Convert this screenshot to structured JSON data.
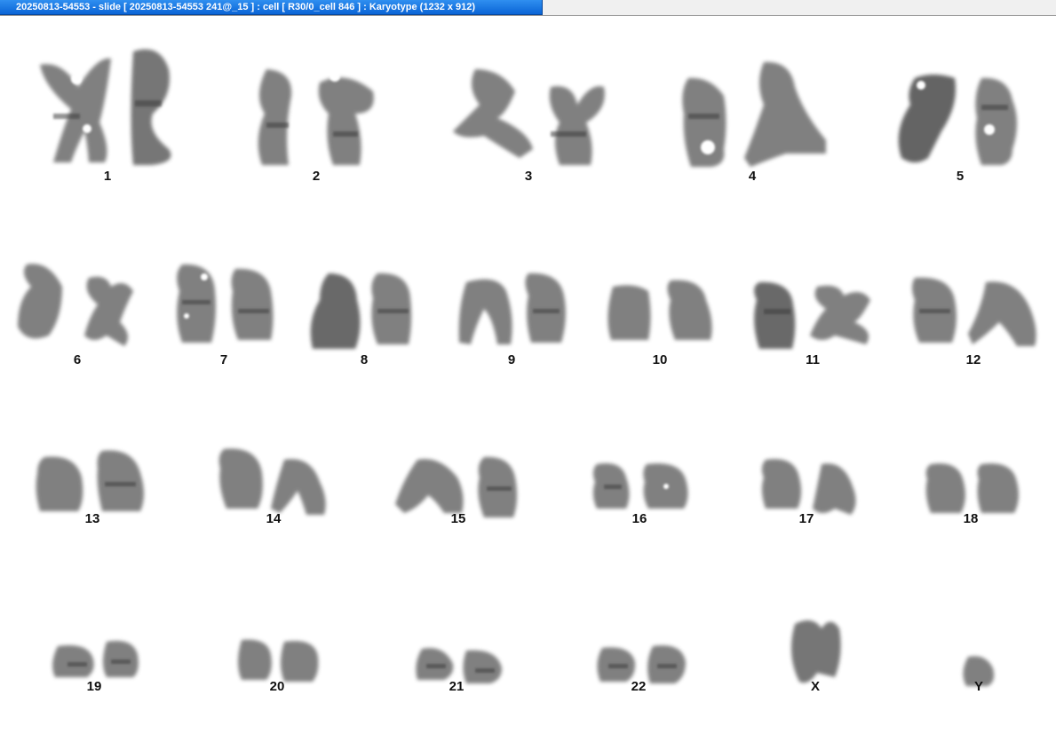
{
  "window": {
    "title": "20250813-54553 - slide [ 20250813-54553 241@_15 ] : cell [ R30/0_cell 846 ] : Karyotype  (1232 x 912)"
  },
  "karyotype": {
    "chromosome_color": "#5a5a5a",
    "labels": {
      "c1": "1",
      "c2": "2",
      "c3": "3",
      "c4": "4",
      "c5": "5",
      "c6": "6",
      "c7": "7",
      "c8": "8",
      "c9": "9",
      "c10": "10",
      "c11": "11",
      "c12": "12",
      "c13": "13",
      "c14": "14",
      "c15": "15",
      "c16": "16",
      "c17": "17",
      "c18": "18",
      "c19": "19",
      "c20": "20",
      "c21": "21",
      "c22": "22",
      "cX": "X",
      "cY": "Y"
    }
  }
}
